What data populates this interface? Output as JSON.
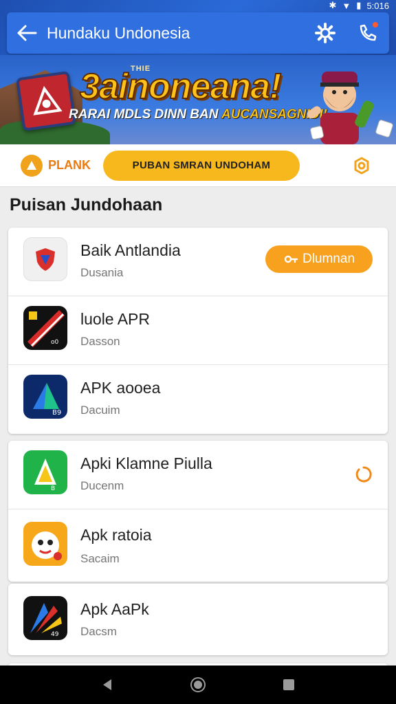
{
  "status": {
    "time": "5:016"
  },
  "appbar": {
    "title": "Hundaku Undonesia",
    "icons": [
      "back-arrow-icon",
      "settings-gear-icon",
      "notification-icon"
    ]
  },
  "banner": {
    "tag": "THIE",
    "title": "3ainoneana!",
    "sub_left": "RARAI MDLS DINN BAN",
    "sub_right": "AUCANSAGNIDI!"
  },
  "search_row": {
    "plank_label": "PLANK",
    "search_label": "PUBAN SMRAN UNDOHAM"
  },
  "section_title": "Puisan Jundohaan",
  "apps": [
    {
      "name": "Baik Antlandia",
      "subtitle": "Dusania",
      "button": "Dlumnan",
      "icon": "shield-app-icon"
    },
    {
      "name": "luole APR",
      "subtitle": "Dasson",
      "icon": "red-stripe-app-icon"
    },
    {
      "name": "APK aooea",
      "subtitle": "Dacuim",
      "icon": "blue-triangle-app-icon"
    },
    {
      "name": "Apki Klamne Piulla",
      "subtitle": "Ducenm",
      "icon": "green-triangle-app-icon"
    },
    {
      "name": "Apk ratoia",
      "subtitle": "Sacaim",
      "icon": "mascot-face-app-icon"
    },
    {
      "name": "Apk AaPk",
      "subtitle": "Dacsm",
      "icon": "colored-arrow-app-icon"
    }
  ],
  "colors": {
    "primary": "#2f6fe0",
    "accent": "#f7a11e",
    "pill": "#f7b81d"
  }
}
